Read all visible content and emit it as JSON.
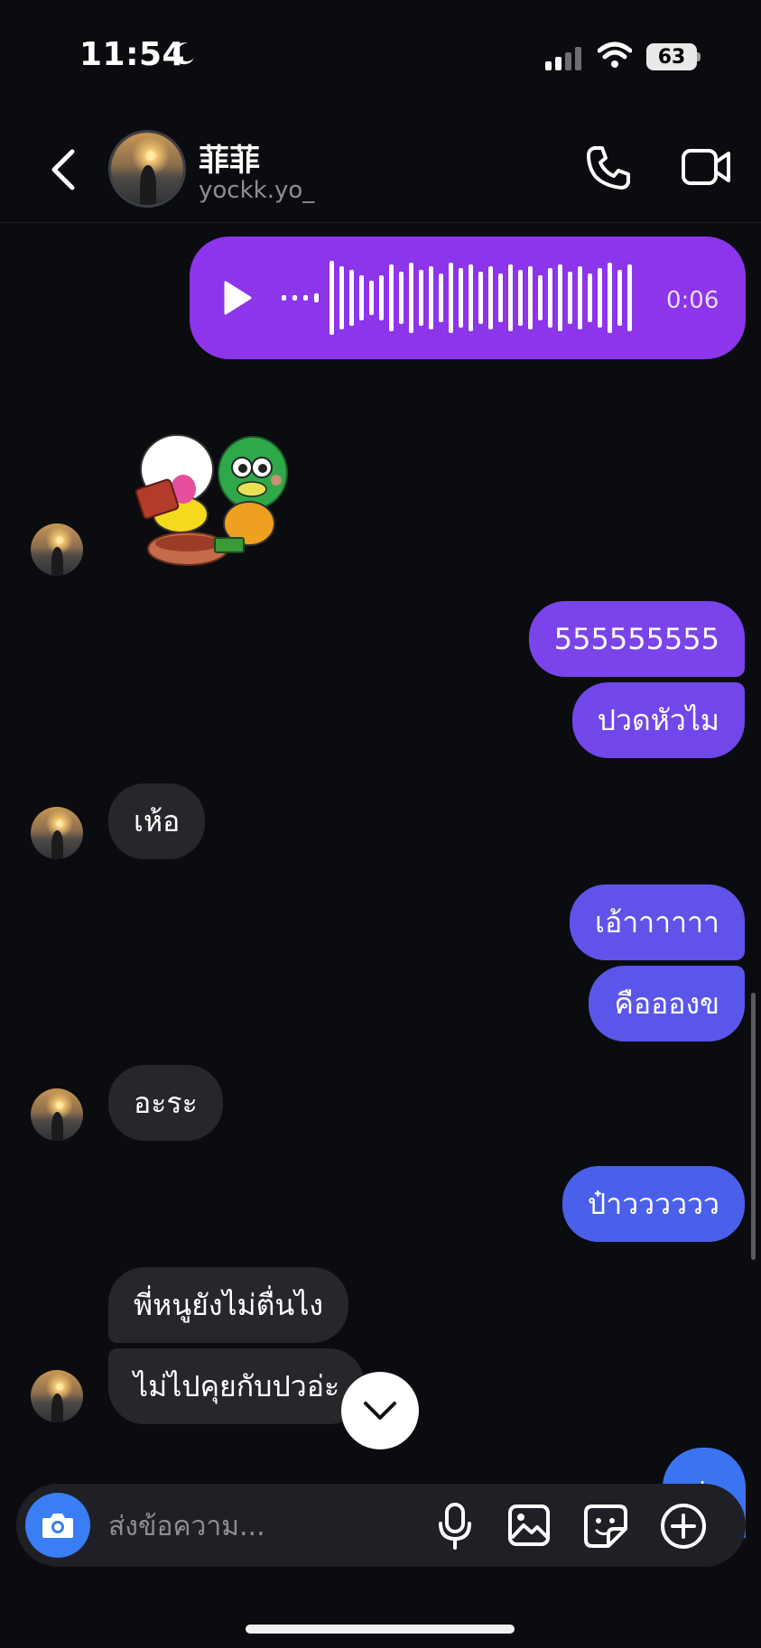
{
  "status": {
    "time": "11:54",
    "battery": "63"
  },
  "header": {
    "name": "菲菲",
    "username": "yockk.yo_"
  },
  "voice_message": {
    "duration": "0:06"
  },
  "messages": [
    {
      "dir": "out",
      "text": "555555555"
    },
    {
      "dir": "out",
      "text": "ปวดหัวไม"
    },
    {
      "dir": "in",
      "text": "เห้อ"
    },
    {
      "dir": "out",
      "text": "เอ้าาาาาา"
    },
    {
      "dir": "out",
      "text": "คืออองข"
    },
    {
      "dir": "in",
      "text": "อะระ"
    },
    {
      "dir": "out",
      "text": "ป๋าวววววว"
    },
    {
      "dir": "in",
      "text": "พี่หนูยังไม่ตื่นไง"
    },
    {
      "dir": "in",
      "text": "ไม่ไปคุยกับปวอ่ะ"
    },
    {
      "dir": "out",
      "text": "ปว"
    }
  ],
  "composer": {
    "placeholder": "ส่งข้อความ..."
  },
  "colors": {
    "voice": "#8c35ea",
    "out_1": "#7b43ea",
    "out_2": "#6b4fe8",
    "out_3": "#5357ea",
    "out_4": "#4566ea",
    "in": "#26272b",
    "accent": "#3a7df5"
  },
  "icons": [
    "back-chevron-icon",
    "voice-call-icon",
    "video-call-icon",
    "play-icon",
    "camera-icon",
    "microphone-icon",
    "gallery-icon",
    "sticker-icon",
    "plus-icon",
    "chevron-down-icon",
    "moon-icon",
    "signal-icon",
    "wifi-icon"
  ]
}
